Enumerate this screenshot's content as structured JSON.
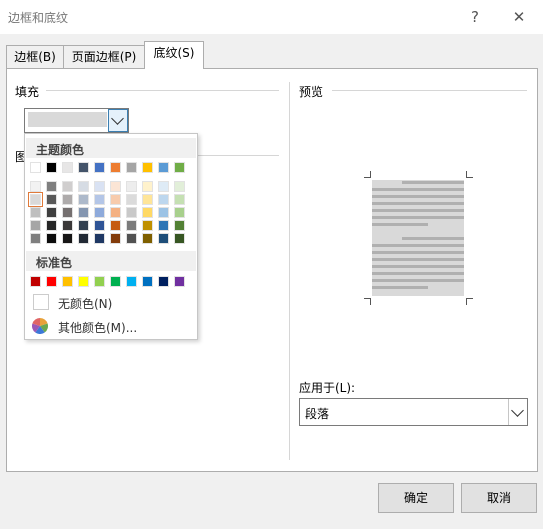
{
  "window": {
    "title": "边框和底纹",
    "help": "?",
    "close": "✕"
  },
  "tabs": [
    {
      "label": "边框(B)",
      "active": false
    },
    {
      "label": "页面边框(P)",
      "active": false
    },
    {
      "label": "底纹(S)",
      "active": true
    }
  ],
  "fill": {
    "label": "填充",
    "selected_color": "#d9d9d9"
  },
  "pattern": {
    "label": "图"
  },
  "preview": {
    "label": "预览"
  },
  "color_popup": {
    "theme_header": "主题颜色",
    "standard_header": "标准色",
    "theme_top_row": [
      "#ffffff",
      "#000000",
      "#e7e6e6",
      "#44546a",
      "#4472c4",
      "#ed7d31",
      "#a5a5a5",
      "#ffc000",
      "#5b9bd5",
      "#70ad47"
    ],
    "theme_shades": [
      [
        "#f2f2f2",
        "#7f7f7f",
        "#d0cece",
        "#d6dce4",
        "#d9e2f3",
        "#fbe5d5",
        "#ededed",
        "#fff2cc",
        "#deebf6",
        "#e2efd9"
      ],
      [
        "#d9d9d9",
        "#595959",
        "#aeabab",
        "#adb9ca",
        "#b4c6e7",
        "#f7cbac",
        "#dbdbdb",
        "#fee599",
        "#bdd7ee",
        "#c5e0b3"
      ],
      [
        "#bfbfbf",
        "#3f3f3f",
        "#757070",
        "#8496b0",
        "#8eaadb",
        "#f4b183",
        "#c9c9c9",
        "#ffd965",
        "#9cc3e5",
        "#a8d08d"
      ],
      [
        "#a6a6a6",
        "#262626",
        "#3a3838",
        "#323f4f",
        "#2f5496",
        "#c55a11",
        "#7b7b7b",
        "#bf9000",
        "#2e75b5",
        "#538135"
      ],
      [
        "#7f7f7f",
        "#0c0c0c",
        "#171616",
        "#222a35",
        "#1f3864",
        "#833c0b",
        "#525252",
        "#7f6000",
        "#1e4e79",
        "#375623"
      ]
    ],
    "standard_colors": [
      "#c00000",
      "#ff0000",
      "#ffc000",
      "#ffff00",
      "#92d050",
      "#00b050",
      "#00b0f0",
      "#0070c0",
      "#002060",
      "#7030a0"
    ],
    "no_color_label": "无颜色(N)",
    "more_colors_label": "其他颜色(M)..."
  },
  "apply_to": {
    "label": "应用于(L):",
    "value": "段落"
  },
  "buttons": {
    "ok": "确定",
    "cancel": "取消"
  }
}
